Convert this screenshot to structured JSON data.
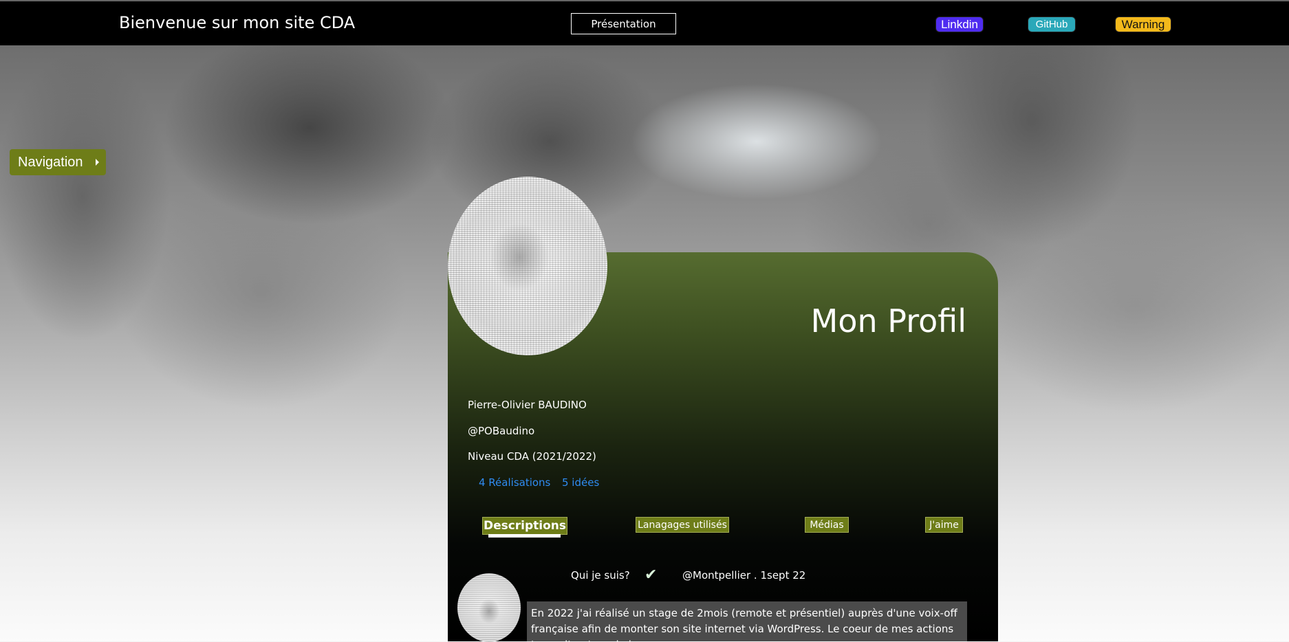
{
  "header": {
    "site_title": "Bienvenue sur mon site CDA",
    "presentation_label": "Présentation",
    "links": {
      "linkdin": "Linkdin",
      "github": "GitHub",
      "warning": "Warning"
    }
  },
  "sidebar": {
    "navigation_label": "Navigation"
  },
  "profile": {
    "title": "Mon Profil",
    "name": "Pierre-Olivier BAUDINO",
    "handle": "@POBaudino",
    "level": "Niveau CDA (2021/2022)",
    "stats": {
      "realisations": "4 Réalisations",
      "ideas": "5 idées"
    }
  },
  "tabs": {
    "descriptions": "Descriptions",
    "languages": "Lanagages utilisés",
    "media": "Médias",
    "likes": "J'aime"
  },
  "post": {
    "who": "Qui je suis?",
    "check": "✔",
    "location_date": "@Montpellier . 1sept 22",
    "description": "En 2022 j'ai réalisé un stage de 2mois (remote et présentiel) auprès d'une voix-off française afin de monter son site internet via WordPress. Le coeur de mes actions tournait autour de la"
  },
  "colors": {
    "topbar": "#000000",
    "olive_accent": "#6e7d18",
    "linkdin": "#4f2cf0",
    "github": "#2aa8b9",
    "warning": "#f3b91b",
    "stat_link": "#2f8cf2"
  }
}
